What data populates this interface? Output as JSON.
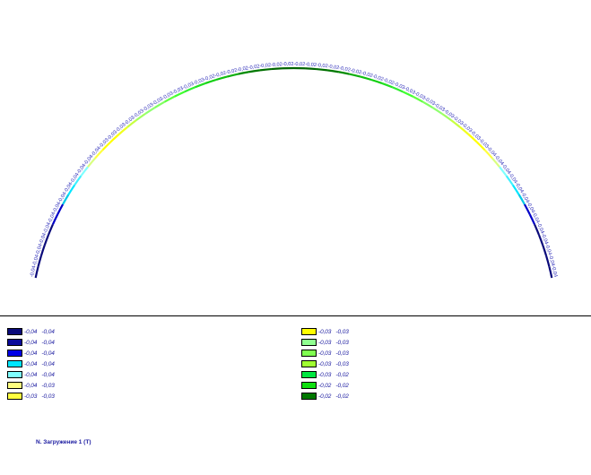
{
  "diagram": {
    "segments": [
      {
        "value": "-0,04",
        "color": "#0a0a7a"
      },
      {
        "value": "-0,04",
        "color": "#0a0a7a"
      },
      {
        "value": "-0,04",
        "color": "#0a0a7a"
      },
      {
        "value": "-0,04",
        "color": "#0a0a7a"
      },
      {
        "value": "-0,04",
        "color": "#0a0a7a"
      },
      {
        "value": "-0,04",
        "color": "#0000c8"
      },
      {
        "value": "-0,04",
        "color": "#0000c8"
      },
      {
        "value": "-0,04",
        "color": "#00c8e6"
      },
      {
        "value": "-0,04",
        "color": "#00e6ff"
      },
      {
        "value": "-0,04",
        "color": "#40f0ff"
      },
      {
        "value": "-0,04",
        "color": "#80ffff"
      },
      {
        "value": "-0,04",
        "color": "#d8ff80"
      },
      {
        "value": "-0,04",
        "color": "#ffff40"
      },
      {
        "value": "-0,03",
        "color": "#ffff00"
      },
      {
        "value": "-0,03",
        "color": "#ffff00"
      },
      {
        "value": "-0,03",
        "color": "#f0ff20"
      },
      {
        "value": "-0,03",
        "color": "#c8ff40"
      },
      {
        "value": "-0,03",
        "color": "#a0ff60"
      },
      {
        "value": "-0,03",
        "color": "#90ff70"
      },
      {
        "value": "-0,03",
        "color": "#80ff60"
      },
      {
        "value": "-0,03",
        "color": "#60ff40"
      },
      {
        "value": "-0,03",
        "color": "#40ff30"
      },
      {
        "value": "-0,03",
        "color": "#30ee30"
      },
      {
        "value": "-0,03",
        "color": "#20e020"
      },
      {
        "value": "-0,02",
        "color": "#10d010"
      },
      {
        "value": "-0,02",
        "color": "#10c010"
      },
      {
        "value": "-0,02",
        "color": "#10b010"
      },
      {
        "value": "-0,02",
        "color": "#008c00"
      },
      {
        "value": "-0,02",
        "color": "#007800"
      },
      {
        "value": "-0,02",
        "color": "#006e00"
      },
      {
        "value": "-0,02",
        "color": "#006400"
      },
      {
        "value": "-0,02",
        "color": "#006400"
      },
      {
        "value": "-0,02",
        "color": "#006400"
      },
      {
        "value": "-0,02",
        "color": "#006400"
      },
      {
        "value": "-0,02",
        "color": "#006e00"
      },
      {
        "value": "-0,02",
        "color": "#007800"
      },
      {
        "value": "-0,02",
        "color": "#008c00"
      },
      {
        "value": "-0,02",
        "color": "#10b010"
      },
      {
        "value": "-0,02",
        "color": "#10c010"
      },
      {
        "value": "-0,02",
        "color": "#10d010"
      },
      {
        "value": "-0,02",
        "color": "#20e020"
      },
      {
        "value": "-0,03",
        "color": "#30ee30"
      },
      {
        "value": "-0,03",
        "color": "#40ff30"
      },
      {
        "value": "-0,03",
        "color": "#60ff40"
      },
      {
        "value": "-0,03",
        "color": "#80ff60"
      },
      {
        "value": "-0,03",
        "color": "#90ff70"
      },
      {
        "value": "-0,03",
        "color": "#a0ff60"
      },
      {
        "value": "-0,03",
        "color": "#c8ff40"
      },
      {
        "value": "-0,03",
        "color": "#f0ff20"
      },
      {
        "value": "-0,03",
        "color": "#ffff00"
      },
      {
        "value": "-0,03",
        "color": "#ffff00"
      },
      {
        "value": "-0,04",
        "color": "#ffff40"
      },
      {
        "value": "-0,04",
        "color": "#d8ff80"
      },
      {
        "value": "-0,04",
        "color": "#80ffff"
      },
      {
        "value": "-0,04",
        "color": "#40f0ff"
      },
      {
        "value": "-0,04",
        "color": "#00e6ff"
      },
      {
        "value": "-0,04",
        "color": "#00c8e6"
      },
      {
        "value": "-0,04",
        "color": "#0000c8"
      },
      {
        "value": "-0,04",
        "color": "#0000c8"
      },
      {
        "value": "-0,04",
        "color": "#0a0a7a"
      },
      {
        "value": "-0,04",
        "color": "#0a0a7a"
      },
      {
        "value": "-0,04",
        "color": "#0a0a7a"
      },
      {
        "value": "-0,04",
        "color": "#0a0a7a"
      },
      {
        "value": "-0,04",
        "color": "#0a0a7a"
      }
    ]
  },
  "legend": {
    "left": [
      {
        "from": "-0,04",
        "to": "-0,04",
        "color": "#0a0a7a"
      },
      {
        "from": "-0,04",
        "to": "-0,04",
        "color": "#0a0a9a"
      },
      {
        "from": "-0,04",
        "to": "-0,04",
        "color": "#0000e6"
      },
      {
        "from": "-0,04",
        "to": "-0,04",
        "color": "#00e6ff"
      },
      {
        "from": "-0,04",
        "to": "-0,04",
        "color": "#80ffff"
      },
      {
        "from": "-0,04",
        "to": "-0,03",
        "color": "#ffff80"
      },
      {
        "from": "-0,03",
        "to": "-0,03",
        "color": "#ffff40"
      }
    ],
    "right": [
      {
        "from": "-0,03",
        "to": "-0,03",
        "color": "#ffff00"
      },
      {
        "from": "-0,03",
        "to": "-0,03",
        "color": "#90ff90"
      },
      {
        "from": "-0,03",
        "to": "-0,03",
        "color": "#80ff50"
      },
      {
        "from": "-0,03",
        "to": "-0,03",
        "color": "#a0ff30"
      },
      {
        "from": "-0,03",
        "to": "-0,02",
        "color": "#00e640"
      },
      {
        "from": "-0,02",
        "to": "-0,02",
        "color": "#10e010"
      },
      {
        "from": "-0,02",
        "to": "-0,02",
        "color": "#007800"
      }
    ]
  },
  "caption": "N. Загружение 1 (Т)"
}
